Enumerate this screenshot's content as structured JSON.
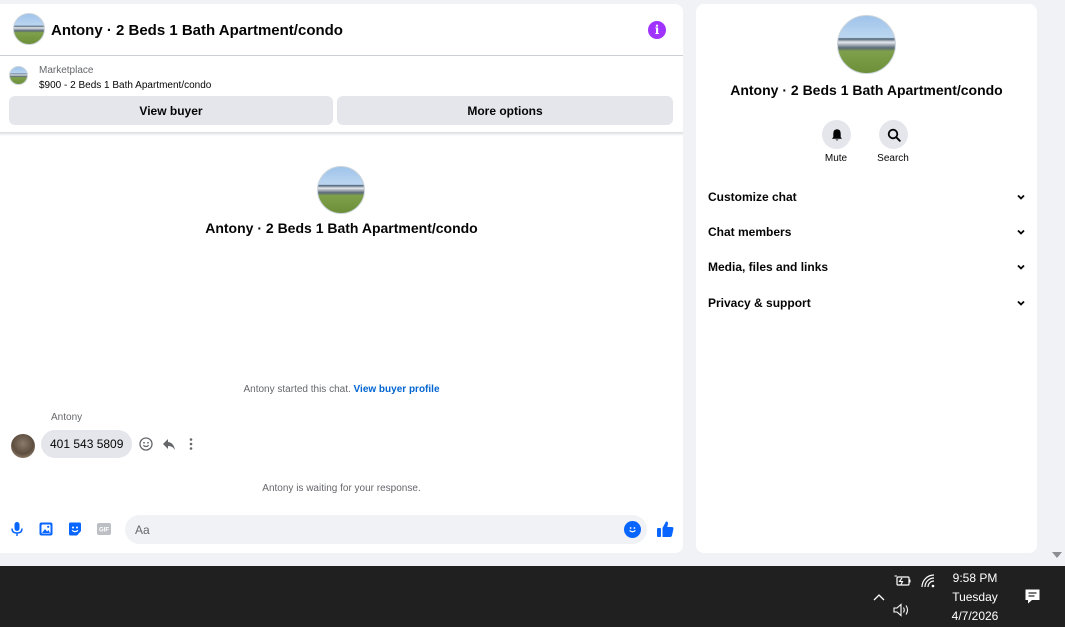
{
  "chat": {
    "title": "Antony · 2 Beds 1 Bath Apartment/condo",
    "listing_label": "Marketplace",
    "listing_price": "$900 - 2 Beds 1 Bath Apartment/condo",
    "view_buyer_label": "View buyer",
    "more_options_label": "More options",
    "center_title": "Antony · 2 Beds 1 Bath Apartment/condo",
    "started_text": "Antony started this chat.",
    "started_link": "View buyer profile",
    "sender_name": "Antony",
    "message_text": "401 543 5809",
    "waiting_text": "Antony is waiting for your response.",
    "composer_placeholder": "Aa",
    "info_glyph": "i"
  },
  "details": {
    "title": "Antony · 2 Beds 1 Bath Apartment/condo",
    "mute_label": "Mute",
    "search_label": "Search",
    "sections": [
      {
        "label": "Customize chat"
      },
      {
        "label": "Chat members"
      },
      {
        "label": "Media, files and links"
      },
      {
        "label": "Privacy & support"
      }
    ]
  },
  "taskbar": {
    "time": "9:58 PM",
    "day": "Tuesday",
    "date": "4/7/2026"
  },
  "colors": {
    "accent": "#0866ff",
    "info": "#a033ff",
    "link": "#0064d1"
  },
  "icons": [
    "info-icon",
    "mic-icon",
    "image-icon",
    "sticker-icon",
    "gif-icon",
    "emoji-icon",
    "thumbs-up-icon",
    "react-icon",
    "reply-icon",
    "more-icon",
    "bell-icon",
    "search-icon",
    "chevron-down-icon",
    "battery-icon",
    "wifi-icon",
    "volume-icon",
    "notification-icon"
  ]
}
